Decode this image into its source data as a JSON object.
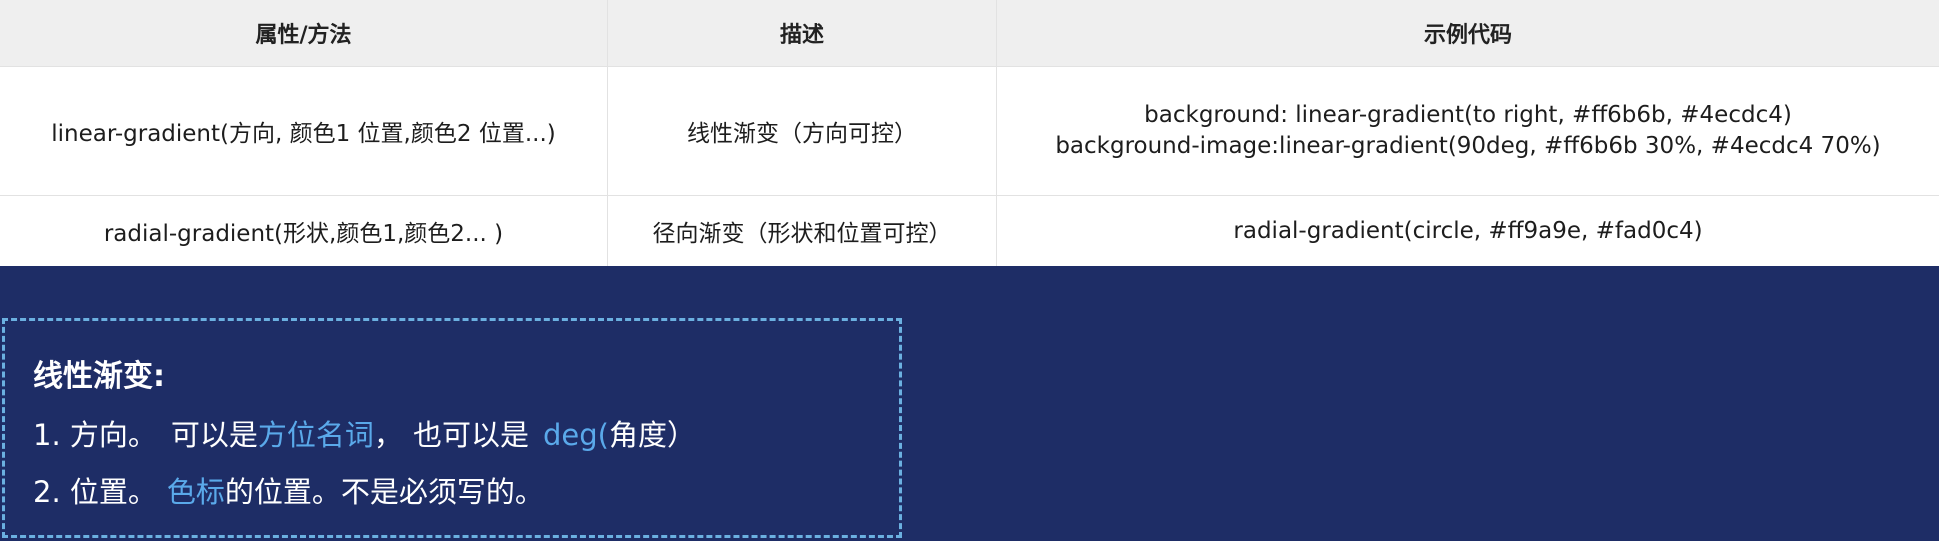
{
  "table": {
    "headers": [
      "属性/方法",
      "描述",
      "示例代码"
    ],
    "rows": [
      {
        "method": "linear-gradient(方向, 颜色1  位置,颜色2  位置...)",
        "desc": "线性渐变（方向可控）",
        "code": [
          "background: linear-gradient(to right, #ff6b6b, #4ecdc4)",
          "background-image:linear-gradient(90deg, #ff6b6b 30%, #4ecdc4 70%)"
        ]
      },
      {
        "method": "radial-gradient(形状,颜色1,颜色2... )",
        "desc": "径向渐变（形状和位置可控）",
        "code": [
          "radial-gradient(circle, #ff9a9e, #fad0c4)"
        ]
      }
    ]
  },
  "note": {
    "title": "线性渐变:",
    "line1": {
      "a": "1. 方向。",
      "b": "可以是",
      "c": "方位名词",
      "d": "，",
      "e": "也可以是",
      "f": "deg(",
      "g": "角度）"
    },
    "line2": {
      "a": "2. 位置。",
      "b": "色标",
      "c": "的位置。不是必须写的。"
    }
  },
  "colors": {
    "background": "#1e2d66",
    "highlight": "#5aa9ea",
    "dashed_border": "#6bb0e0"
  }
}
